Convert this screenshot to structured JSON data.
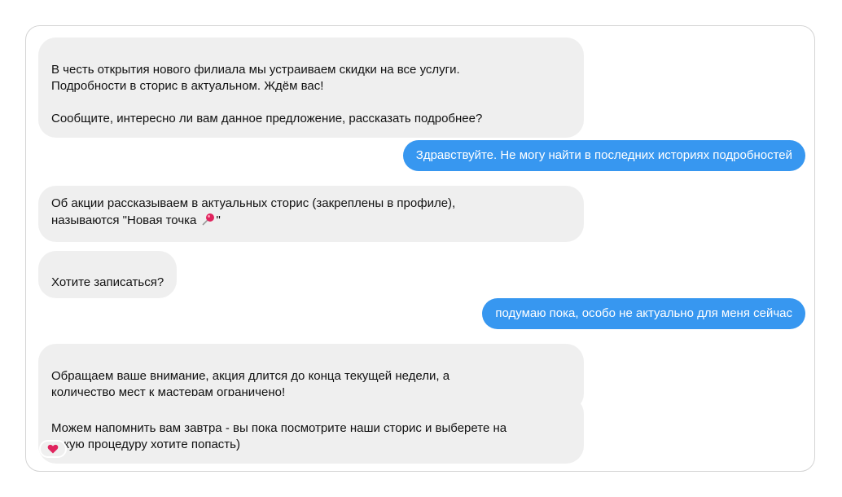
{
  "conversation": {
    "messages": [
      {
        "sender": "business",
        "text": "В честь открытия нового филиала мы устраиваем скидки на все услуги.\nПодробности в сторис в актуальном. Ждём вас!\n\nСообщите, интересно ли вам данное предложение, рассказать подробнее?"
      },
      {
        "sender": "user",
        "text": "Здравствуйте. Не могу найти в последних историях подробностей"
      },
      {
        "sender": "business",
        "text_before_icon": "Об акции рассказываем в актуальных сторис (закреплены в профиле),\nназываются \"Новая точка ",
        "icon": "round-pushpin-icon",
        "text_after_icon": "\""
      },
      {
        "sender": "business",
        "text": "Хотите записаться?"
      },
      {
        "sender": "user",
        "text": "подумаю пока, особо не актуально для меня сейчас"
      },
      {
        "sender": "business",
        "text": "Обращаем ваше внимание, акция длится до конца текущей недели, а\nколичество мест к мастерам ограничено!"
      },
      {
        "sender": "business",
        "text": "Можем напомнить вам завтра - вы пока посмотрите наши сторис и выберете на\nкакую процедуру хотите попасть)",
        "reaction": "heart-icon"
      }
    ]
  },
  "colors": {
    "incoming_bubble": "#efefef",
    "outgoing_bubble": "#3797f0",
    "heart": "#e0245e"
  }
}
